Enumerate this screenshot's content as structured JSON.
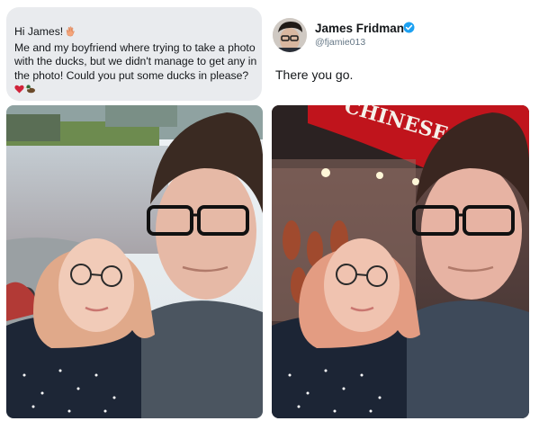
{
  "request_message": {
    "greeting": "Hi James!",
    "lines": [
      "Me and my boyfriend where trying to take a photo",
      "with the ducks, but we didn't manage to get any in",
      "the photo! Could you put some ducks in please?"
    ],
    "emoji_icons": [
      "waving-hand-icon",
      "heart-icon",
      "duck-icon"
    ]
  },
  "reply": {
    "author_name": "James Fridman",
    "author_handle": "@fjamie013",
    "verified_icon": "verified-badge-icon",
    "text": "There you go."
  },
  "photos": {
    "original": {
      "scene": "pond-park"
    },
    "edited": {
      "scene": "chinese-restaurant-window",
      "sign_text": "CHINESE"
    }
  },
  "colors": {
    "bubble": "#e9ebee",
    "verified": "#1da1f2",
    "handle": "#657786",
    "sign_red": "#c0141c"
  }
}
